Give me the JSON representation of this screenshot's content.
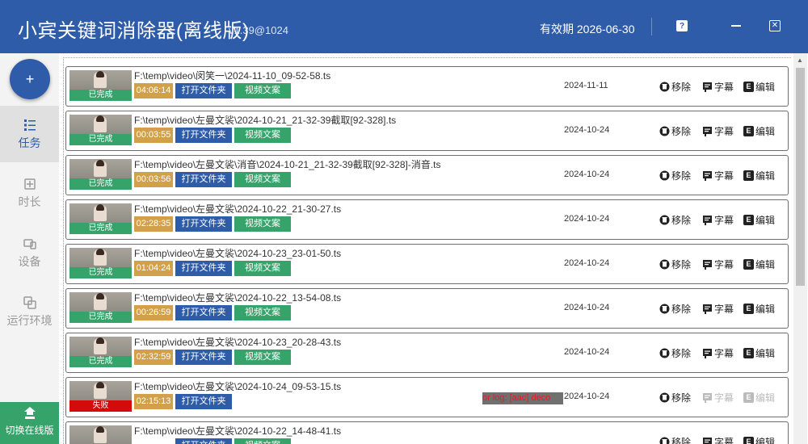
{
  "app": {
    "title": "小宾关键词消除器(离线版)",
    "version": "v1.39@1024",
    "validity": "有效期 2026-06-30",
    "help_label": "?",
    "close_label": "✕"
  },
  "sidebar": {
    "add_label": "+",
    "items": [
      {
        "label": "任务",
        "icon": "task-list-icon",
        "active": true
      },
      {
        "label": "时长",
        "icon": "duration-icon",
        "active": false
      },
      {
        "label": "设备",
        "icon": "device-icon",
        "active": false
      },
      {
        "label": "运行环境",
        "icon": "environment-icon",
        "active": false
      }
    ],
    "switch_label": "切换在线版"
  },
  "actions": {
    "remove": "移除",
    "subtitle": "字幕",
    "edit": "编辑",
    "open_folder": "打开文件夹",
    "video_copy": "视频文案"
  },
  "tasks": [
    {
      "path": "F:\\temp\\video\\闵笑一\\2024-11-10_09-52-58.ts",
      "status": "已完成",
      "duration": "04:06:14",
      "date": "2024-11-11"
    },
    {
      "path": "F:\\temp\\video\\左曼文裟\\2024-10-21_21-32-39截取[92-328].ts",
      "status": "已完成",
      "duration": "00:03:55",
      "date": "2024-10-24"
    },
    {
      "path": "F:\\temp\\video\\左曼文裟\\消音\\2024-10-21_21-32-39截取[92-328]-消音.ts",
      "status": "已完成",
      "duration": "00:03:56",
      "date": "2024-10-24"
    },
    {
      "path": "F:\\temp\\video\\左曼文裟\\2024-10-22_21-30-27.ts",
      "status": "已完成",
      "duration": "02:28:35",
      "date": "2024-10-24"
    },
    {
      "path": "F:\\temp\\video\\左曼文裟\\2024-10-23_23-01-50.ts",
      "status": "已完成",
      "duration": "01:04:24",
      "date": "2024-10-24"
    },
    {
      "path": "F:\\temp\\video\\左曼文裟\\2024-10-22_13-54-08.ts",
      "status": "已完成",
      "duration": "00:26:59",
      "date": "2024-10-24"
    },
    {
      "path": "F:\\temp\\video\\左曼文裟\\2024-10-23_20-28-43.ts",
      "status": "已完成",
      "duration": "02:32:59",
      "date": "2024-10-24"
    },
    {
      "path": "F:\\temp\\video\\左曼文裟\\2024-10-24_09-53-15.ts",
      "status": "失败",
      "duration": "02:15:13",
      "date": "2024-10-24",
      "error": "or log: [aac] deco",
      "failed": true
    },
    {
      "path": "F:\\temp\\video\\左曼文裟\\2024-10-22_14-48-41.ts",
      "status": "已完成",
      "duration": "",
      "date": ""
    }
  ],
  "colors": {
    "primary": "#2e5ca8",
    "success": "#35a36a",
    "duration": "#d3a04a",
    "failed": "#d40b0b"
  }
}
